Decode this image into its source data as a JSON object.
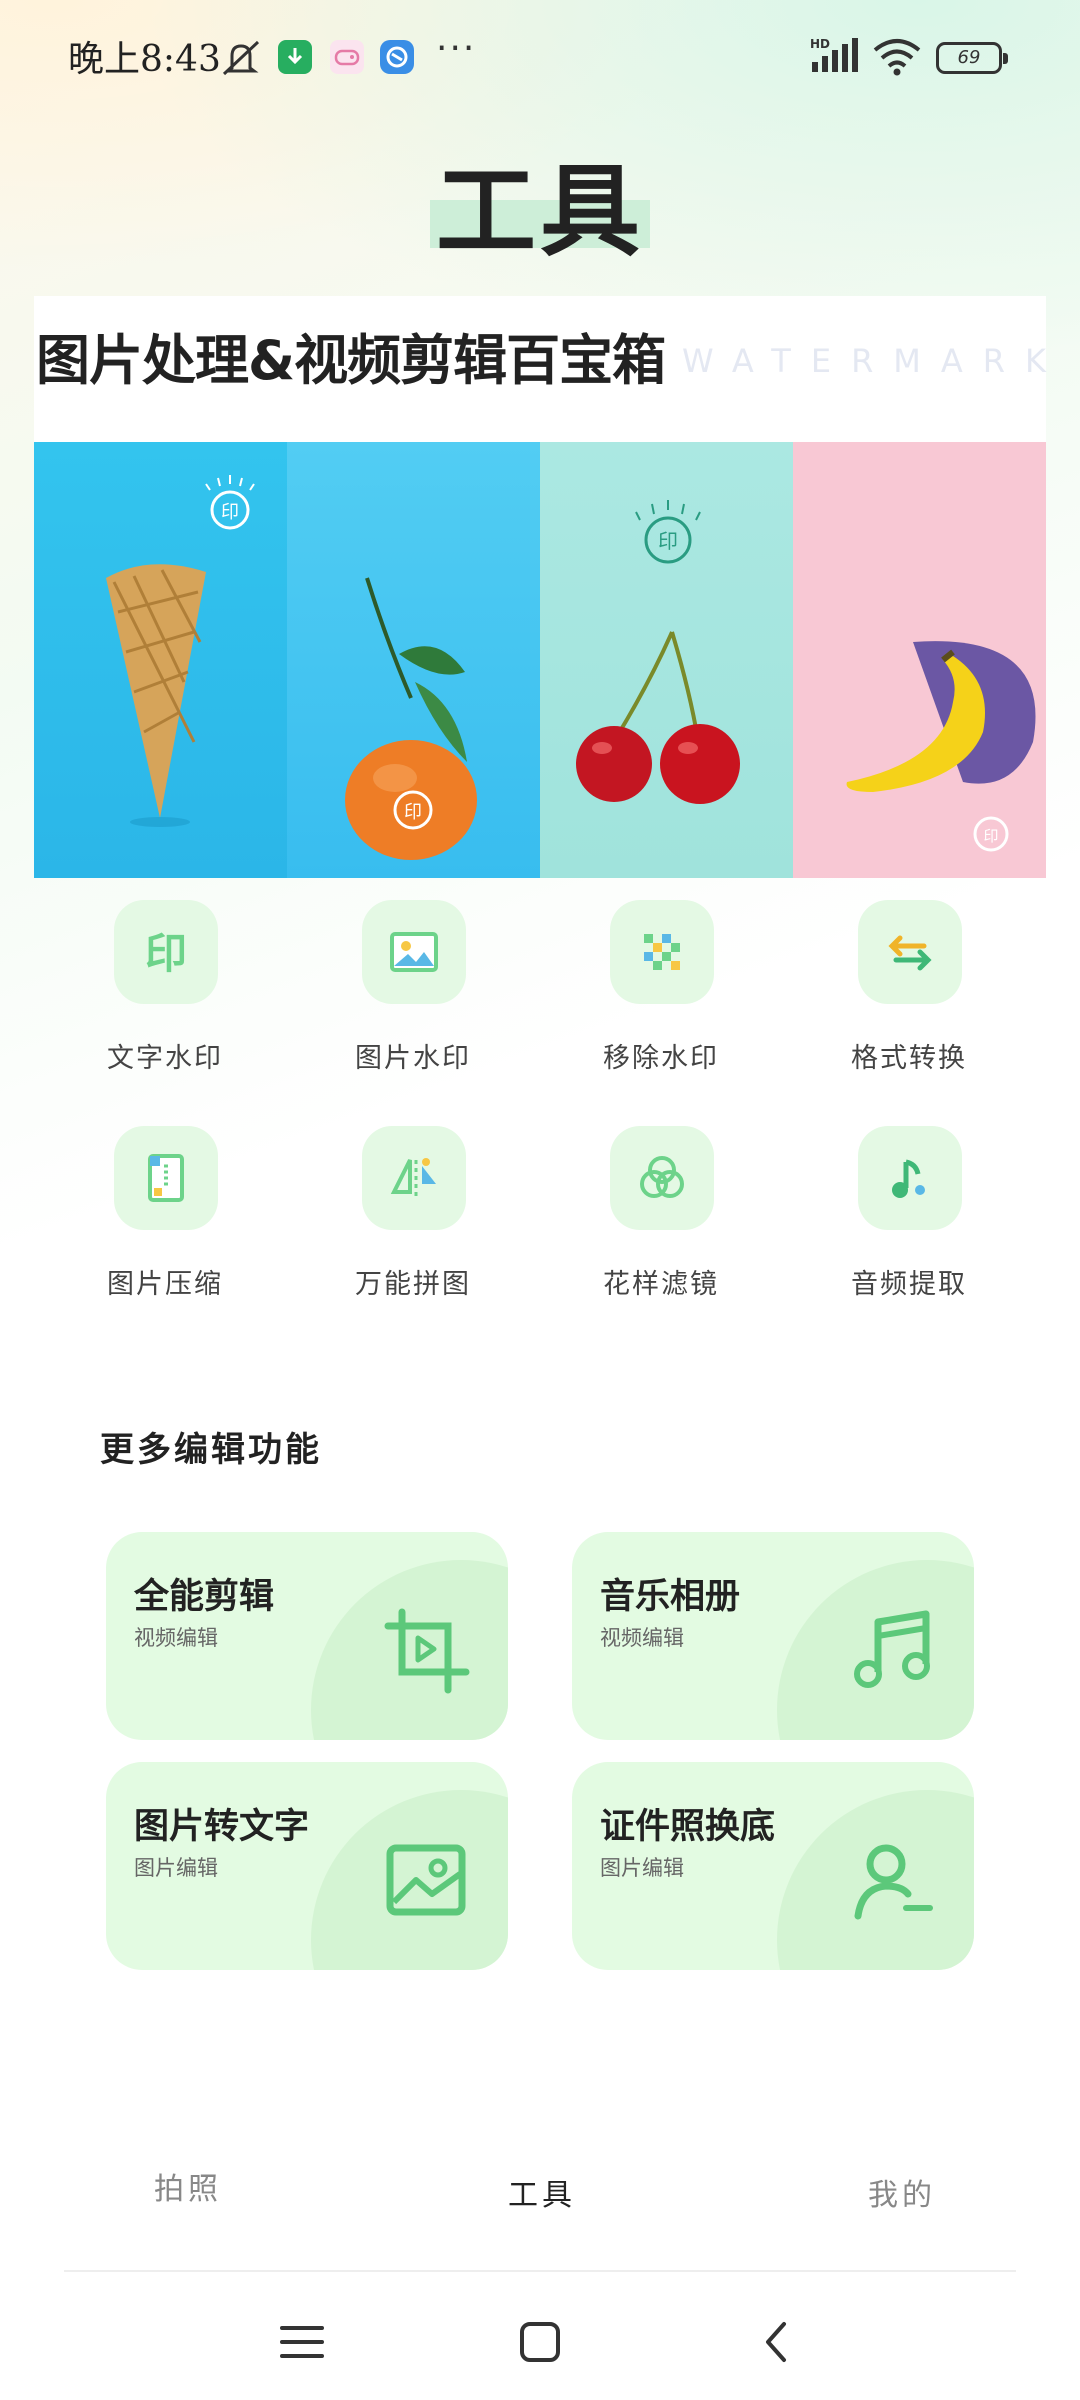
{
  "status_bar": {
    "time": "晚上8:43",
    "more": "···",
    "signal_label": "HD",
    "battery": "69"
  },
  "page": {
    "title": "工具"
  },
  "banner": {
    "title": "图片处理&视频剪辑百宝箱",
    "watermark": "WATERMARK",
    "stamp_text": "印"
  },
  "tools": [
    {
      "label": "文字水印",
      "icon": "text-watermark-icon"
    },
    {
      "label": "图片水印",
      "icon": "image-watermark-icon"
    },
    {
      "label": "移除水印",
      "icon": "remove-watermark-icon"
    },
    {
      "label": "格式转换",
      "icon": "format-convert-icon"
    },
    {
      "label": "图片压缩",
      "icon": "compress-icon"
    },
    {
      "label": "万能拼图",
      "icon": "collage-icon"
    },
    {
      "label": "花样滤镜",
      "icon": "filter-icon"
    },
    {
      "label": "音频提取",
      "icon": "audio-extract-icon"
    }
  ],
  "tool_icon_text": {
    "text_watermark": "印"
  },
  "more": {
    "title": "更多编辑功能",
    "cards": [
      {
        "title": "全能剪辑",
        "sub": "视频编辑",
        "icon": "crop-play-icon"
      },
      {
        "title": "音乐相册",
        "sub": "视频编辑",
        "icon": "music-note-icon"
      },
      {
        "title": "图片转文字",
        "sub": "图片编辑",
        "icon": "picture-icon"
      },
      {
        "title": "证件照换底",
        "sub": "图片编辑",
        "icon": "person-icon"
      }
    ]
  },
  "bottom_nav": {
    "photo": "拍照",
    "tools": "工具",
    "mine": "我的"
  },
  "colors": {
    "accent": "#5cc87a",
    "tile_bg": "#e4f9e4",
    "card_bg": "#e3fbe2"
  }
}
